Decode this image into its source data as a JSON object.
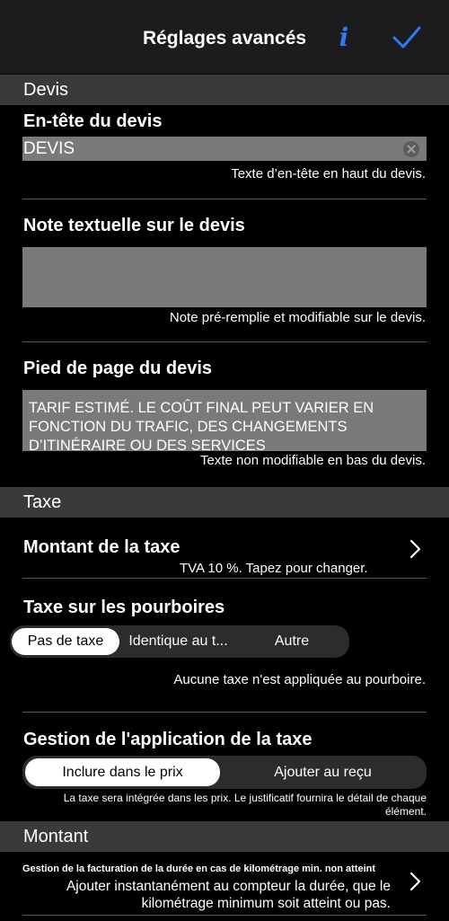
{
  "nav": {
    "title": "Réglages avancés",
    "info_icon": "info-icon",
    "confirm_icon": "checkmark-icon",
    "accent": "#2f7bf5"
  },
  "devis": {
    "header": "Devis",
    "entete_label": "En-tête du devis",
    "entete_value": "DEVIS",
    "entete_hint": "Texte d’en-tête en haut du devis.",
    "note_label": "Note textuelle sur le devis",
    "note_value": "",
    "note_hint": "Note pré-remplie et modifiable sur le devis.",
    "footer_label": "Pied de page du devis",
    "footer_value": "TARIF ESTIMÉ. LE COÛT FINAL PEUT VARIER EN FONCTION DU TRAFIC, DES CHANGEMENTS D’ITINÉRAIRE OU DES SERVICES SUPPLÉMENTAIRES.",
    "footer_hint": "Texte non modifiable en bas du devis."
  },
  "taxe": {
    "header": "Taxe",
    "amount_label": "Montant de la taxe",
    "amount_hint": "TVA 10 %. Tapez pour changer.",
    "tips_label": "Taxe sur les pourboires",
    "tips_options": [
      "Pas de taxe",
      "Identique au t...",
      "Autre"
    ],
    "tips_selected": "Pas de taxe",
    "tips_hint": "Aucune taxe n'est appliquée au pourboire.",
    "apply_label": "Gestion de l'application de la taxe",
    "apply_options": [
      "Inclure dans le prix",
      "Ajouter au reçu"
    ],
    "apply_selected": "Inclure dans le prix",
    "apply_hint": "La taxe sera intégrée dans les prix. Le justificatif fournira le détail de chaque élément."
  },
  "montant": {
    "header": "Montant",
    "duration_label": "Gestion de la facturation de la durée  en cas de kilométrage min. non atteint",
    "duration_hint": "Ajouter instantanément au compteur la durée, que le kilométrage minimum soit atteint ou pas."
  }
}
